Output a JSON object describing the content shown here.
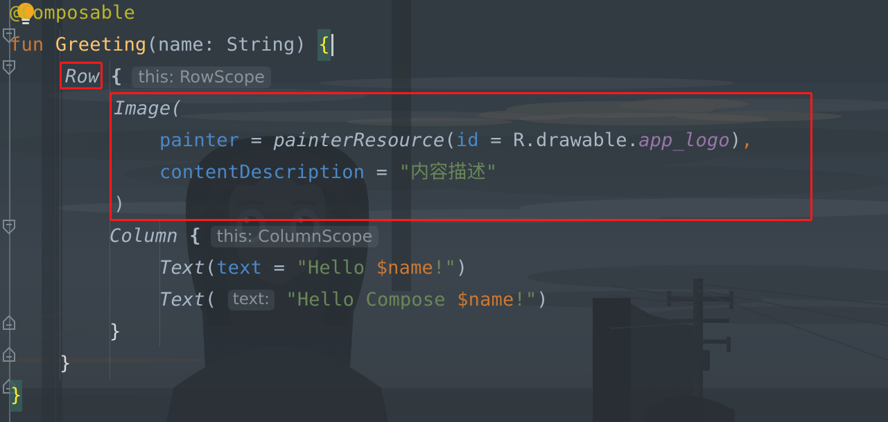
{
  "editor": {
    "language": "Kotlin",
    "theme": "Darcula with background image",
    "caret_line": 2,
    "colors": {
      "annotation": "#BBB529",
      "keyword": "#CC7832",
      "function_name": "#FFC66D",
      "identifier": "#A9B7C6",
      "named_argument": "#4A88C7",
      "string": "#6A8759",
      "string_template": "#CC7832",
      "property": "#9876AA",
      "inlay_hint_text": "#8C9196",
      "brace_highlight": "#FFEF28",
      "brace_highlight_bg": "#3A5F5C",
      "annotation_box": "#FF1A1A",
      "caret": "#C8CDD1"
    }
  },
  "gutter": {
    "icons": [
      {
        "name": "intention-bulb",
        "label": "show-intention-actions"
      },
      {
        "name": "fold-marker-expanded",
        "label": "collapse-fun-greeting"
      },
      {
        "name": "fold-marker-expanded",
        "label": "collapse-row-block"
      },
      {
        "name": "fold-marker-expanded",
        "label": "collapse-column-block"
      },
      {
        "name": "fold-marker-end",
        "label": "fold-end-column"
      },
      {
        "name": "fold-marker-end",
        "label": "fold-end-row"
      },
      {
        "name": "fold-marker-end",
        "label": "fold-end-fun"
      }
    ]
  },
  "code": {
    "line1": {
      "annotation": "@Composable"
    },
    "line2": {
      "kw_fun": "fun",
      "fn_name": " Greeting",
      "paren_open": "(",
      "param_name": "name",
      "colon": ": ",
      "param_type": "String",
      "paren_close": ")",
      "space": " ",
      "brace": "{"
    },
    "line3": {
      "receiver": "Row",
      "space": " ",
      "brace": "{",
      "inlay_hint": "this: RowScope"
    },
    "line4": {
      "fn": "Image("
    },
    "line5": {
      "arg_name": "painter",
      "eq": " = ",
      "call": "painterResource",
      "paren_open": "(",
      "inner_arg": "id",
      "inner_eq": " = ",
      "ref_obj": "R.drawable.",
      "ref_prop": "app_logo",
      "paren_close": ")",
      "comma": ","
    },
    "line6": {
      "arg_name": "contentDescription",
      "eq": " = ",
      "string": "\"内容描述\""
    },
    "line7": {
      "paren_close": ")"
    },
    "line8": {
      "receiver": "Column",
      "space": " ",
      "brace": "{",
      "inlay_hint": "this: ColumnScope"
    },
    "line9": {
      "fn": "Text",
      "paren_open": "(",
      "arg_name": "text",
      "eq": " = ",
      "str_open": "\"Hello ",
      "template": "$name",
      "str_close": "!\"",
      "paren_close": ")"
    },
    "line10": {
      "fn": "Text",
      "paren_open": "( ",
      "inlay_hint": "text:",
      "str_open": " \"Hello Compose ",
      "template": "$name",
      "str_close": "!\"",
      "paren_close": ")"
    },
    "line11": {
      "brace": "}"
    },
    "line12": {
      "brace": "}"
    },
    "line13": {
      "brace": "}"
    }
  },
  "annotations": [
    {
      "name": "row-highlight-box",
      "target": "Row"
    },
    {
      "name": "image-block-highlight-box",
      "target": "Image( ... )"
    }
  ]
}
